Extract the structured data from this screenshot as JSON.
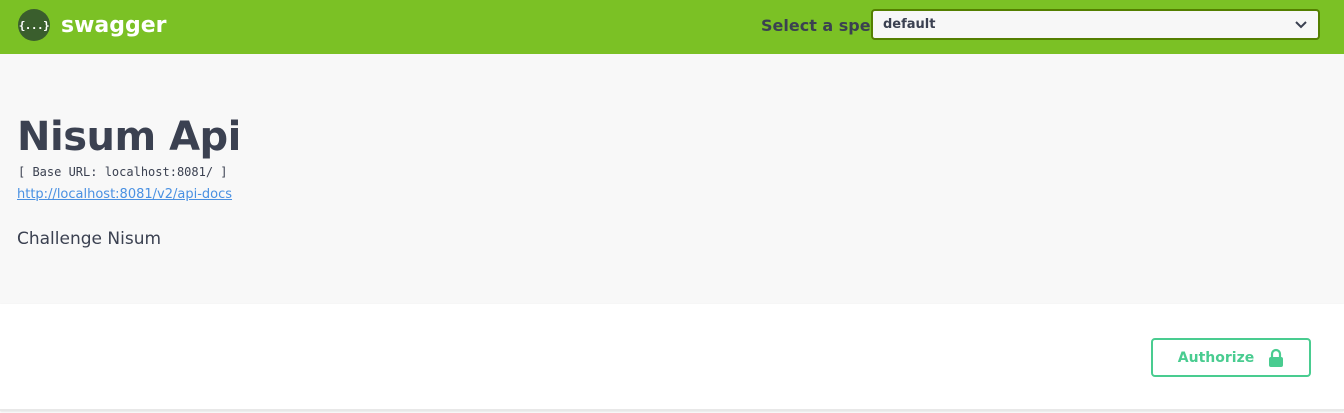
{
  "topbar": {
    "logo_glyph": "{...}",
    "logo_text": "swagger",
    "spec_label": "Select a spec",
    "spec_selected": "default",
    "colors": {
      "background": "#7bc125",
      "select_border": "#547f00"
    }
  },
  "info": {
    "title": "Nisum Api",
    "base_url": "[ Base URL: localhost:8081/ ]",
    "docs_link": "http://localhost:8081/v2/api-docs",
    "description": "Challenge Nisum"
  },
  "scheme": {
    "authorize_label": "Authorize",
    "authorize_icon": "lock-icon",
    "colors": {
      "accent": "#49cc90"
    }
  }
}
